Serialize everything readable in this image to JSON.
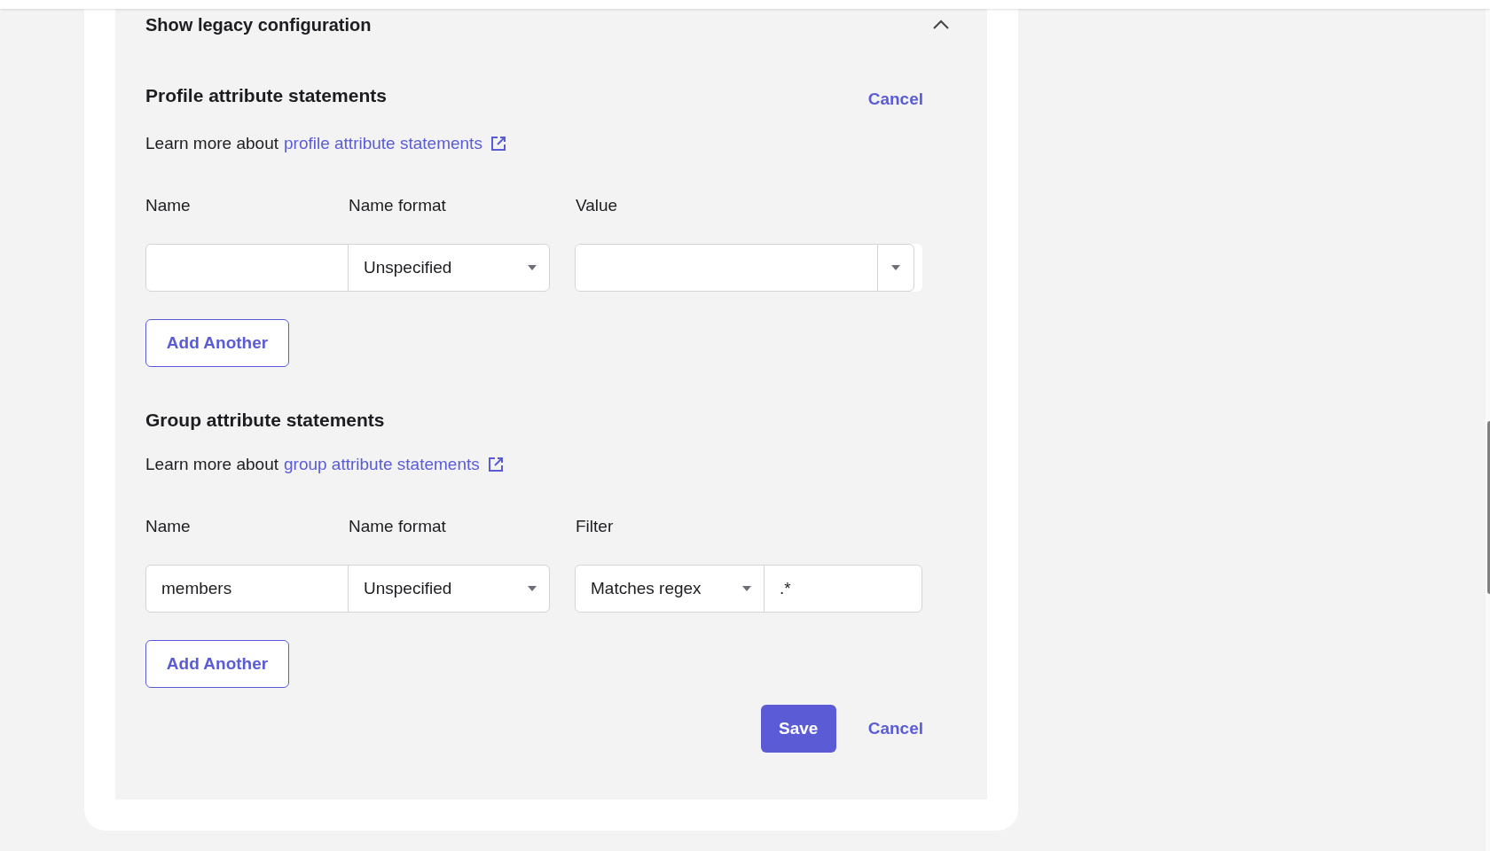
{
  "legacy_section": {
    "title": "Show legacy configuration",
    "expanded": true
  },
  "profile_section": {
    "heading": "Profile attribute statements",
    "cancel": "Cancel",
    "learn_more": {
      "prefix": "Learn more about",
      "link": "profile attribute statements"
    },
    "columns": [
      "Name",
      "Name format",
      "Value"
    ],
    "row": {
      "name_format": "Unspecified"
    },
    "add_button": "Add Another"
  },
  "group_section": {
    "heading": "Group attribute statements",
    "learn_more": {
      "prefix": "Learn more about",
      "link": "group attribute statements"
    },
    "columns": [
      "Name",
      "Name format",
      "Filter"
    ],
    "row": {
      "name": "members",
      "name_format": "Unspecified",
      "filter_type": "Matches regex",
      "filter_value": ".*"
    },
    "add_button": "Add Another"
  },
  "actions": {
    "save": "Save",
    "cancel": "Cancel"
  }
}
